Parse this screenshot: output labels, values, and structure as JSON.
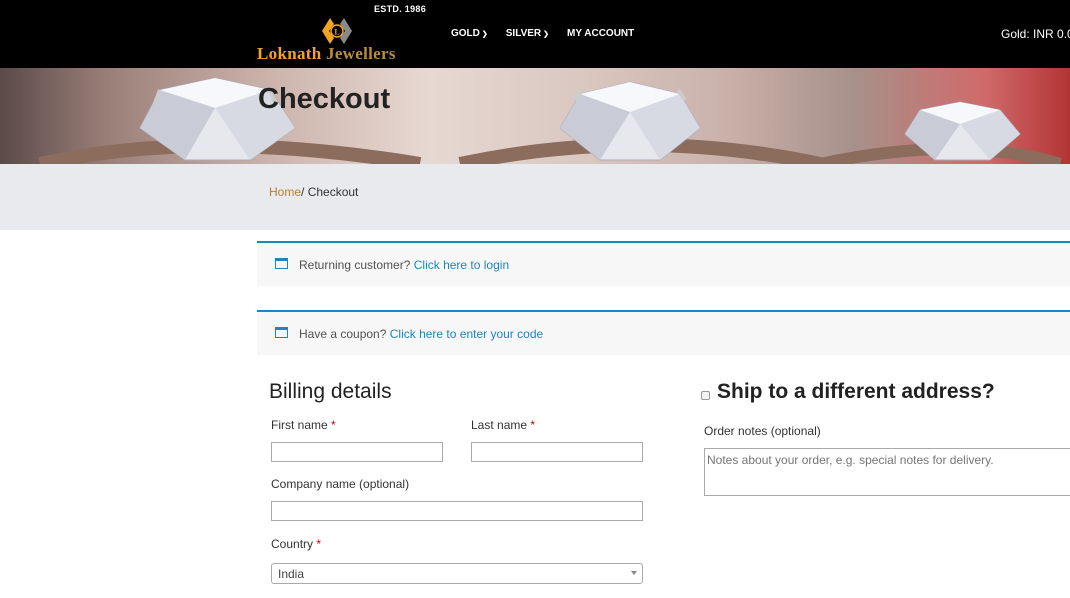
{
  "header": {
    "estd": "ESTD. 1986",
    "logo_word1": "Loknath",
    "logo_word2": "Jewellers",
    "nav": [
      {
        "label": "GOLD",
        "has_dropdown": true
      },
      {
        "label": "SILVER",
        "has_dropdown": true
      },
      {
        "label": "MY ACCOUNT",
        "has_dropdown": false
      }
    ],
    "gold_rate": "Gold: INR 0.0",
    "colors": {
      "logo_primary": "#f2a520",
      "logo_secondary": "#b98c3e",
      "background": "#000000"
    }
  },
  "banner": {
    "title": "Checkout"
  },
  "breadcrumb": {
    "home": "Home",
    "separator": "/",
    "current": " Checkout"
  },
  "notices": {
    "returning": {
      "text": "Returning customer?",
      "link": "Click here to login"
    },
    "coupon": {
      "text": "Have a coupon?",
      "link": "Click here to enter your code"
    },
    "accent": "#1e85be"
  },
  "billing": {
    "heading": "Billing details",
    "first_name_label": "First name",
    "last_name_label": "Last name",
    "company_label": "Company name (optional)",
    "country_label": "Country",
    "required_mark": "*",
    "country_value": "India",
    "first_name_value": "",
    "last_name_value": "",
    "company_value": ""
  },
  "shipping": {
    "heading": "Ship to a different address?",
    "order_notes_label": "Order notes (optional)",
    "order_notes_placeholder": "Notes about your order, e.g. special notes for delivery."
  },
  "icons": {
    "notice": "window-icon",
    "nav_dropdown": "chevron-down-icon",
    "select_caret": "caret-down-icon"
  }
}
